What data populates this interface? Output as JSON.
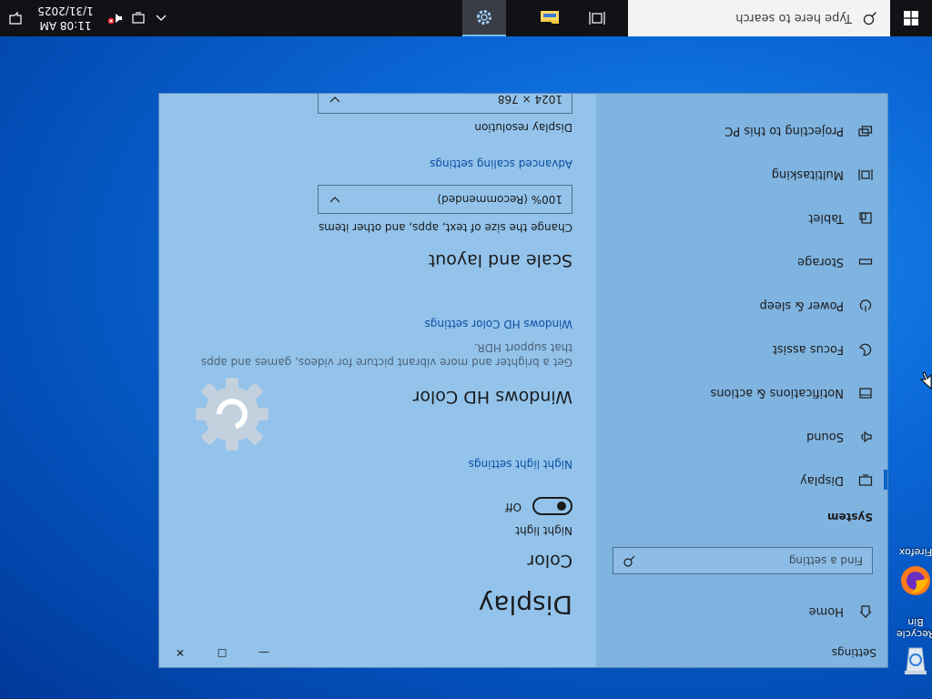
{
  "taskbar": {
    "start_icon": "windows-logo-icon",
    "search_placeholder": "Type here to search",
    "pinned": [
      {
        "name": "task-view",
        "icon": "task-view-icon"
      },
      {
        "name": "file-explorer",
        "icon": "folder-icon"
      },
      {
        "name": "settings",
        "icon": "gear-icon"
      }
    ],
    "tray": {
      "chevron_icon": "chevron-up-icon",
      "network_icon": "network-icon",
      "volume_icon": "volume-muted-icon",
      "time": "11:08 AM",
      "date": "1/31/2025",
      "notification_icon": "notification-icon"
    }
  },
  "desktop": {
    "icons": [
      {
        "label": "Recycle Bin",
        "icon": "recycle-bin-icon"
      },
      {
        "label": "Firefox",
        "icon": "firefox-icon"
      }
    ]
  },
  "window": {
    "title": "Settings",
    "controls": {
      "minimize": "—",
      "maximize": "☐",
      "close": "✕"
    },
    "sidebar": {
      "home_label": "Home",
      "search_placeholder": "Find a setting",
      "section_heading": "System",
      "items": [
        {
          "label": "Display",
          "icon": "display-icon",
          "active": true
        },
        {
          "label": "Sound",
          "icon": "speaker-icon"
        },
        {
          "label": "Notifications & actions",
          "icon": "notifications-icon"
        },
        {
          "label": "Focus assist",
          "icon": "moon-icon"
        },
        {
          "label": "Power & sleep",
          "icon": "power-icon"
        },
        {
          "label": "Storage",
          "icon": "storage-icon"
        },
        {
          "label": "Tablet",
          "icon": "tablet-icon"
        },
        {
          "label": "Multitasking",
          "icon": "multitasking-icon"
        },
        {
          "label": "Projecting to this PC",
          "icon": "projector-icon"
        }
      ]
    },
    "main": {
      "page_title": "Display",
      "color_heading": "Color",
      "night_light_label": "Night light",
      "night_light_state": "Off",
      "night_light_link": "Night light settings",
      "hd_color_heading": "Windows HD Color",
      "hd_color_desc_1": "Get a brighter and more vibrant picture for videos, games and apps",
      "hd_color_desc_2": "that support HDR.",
      "hd_color_link": "Windows HD Color settings",
      "scale_heading": "Scale and layout",
      "scale_desc": "Change the size of text, apps, and other items",
      "scale_value": "100% (Recommended)",
      "advanced_scaling_link": "Advanced scaling settings",
      "resolution_label": "Display resolution",
      "resolution_value": "1024 × 768"
    },
    "loading_icon": "settings-gear-loading-icon"
  },
  "colors": {
    "desktop_blue": "#0a67d6",
    "taskbar": "#101216",
    "window_bg": "#93c3eb",
    "sidebar_bg": "#7fb3e0",
    "accent": "#0a63c9",
    "link": "#0a4fa3"
  }
}
